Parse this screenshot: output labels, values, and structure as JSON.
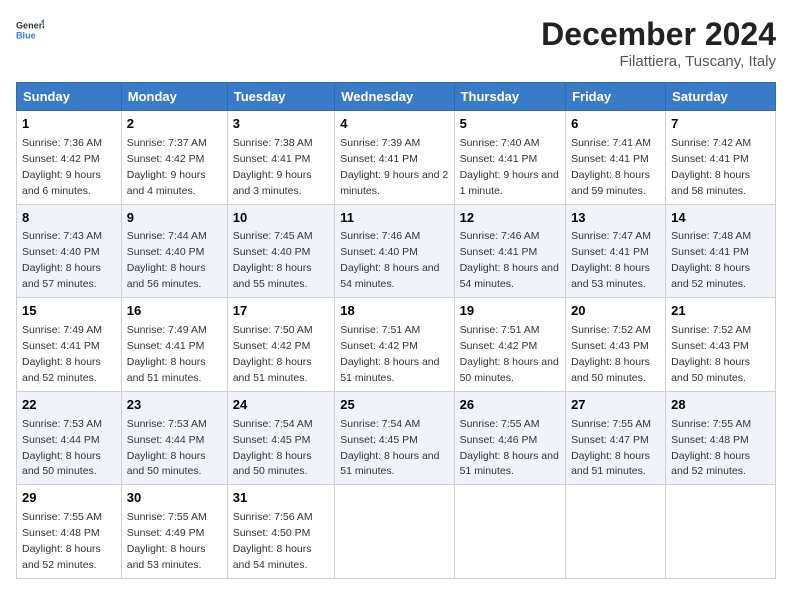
{
  "header": {
    "logo_general": "General",
    "logo_blue": "Blue",
    "title": "December 2024",
    "subtitle": "Filattiera, Tuscany, Italy"
  },
  "days_of_week": [
    "Sunday",
    "Monday",
    "Tuesday",
    "Wednesday",
    "Thursday",
    "Friday",
    "Saturday"
  ],
  "weeks": [
    [
      {
        "day": "1",
        "sunrise": "7:36 AM",
        "sunset": "4:42 PM",
        "daylight": "9 hours and 6 minutes."
      },
      {
        "day": "2",
        "sunrise": "7:37 AM",
        "sunset": "4:42 PM",
        "daylight": "9 hours and 4 minutes."
      },
      {
        "day": "3",
        "sunrise": "7:38 AM",
        "sunset": "4:41 PM",
        "daylight": "9 hours and 3 minutes."
      },
      {
        "day": "4",
        "sunrise": "7:39 AM",
        "sunset": "4:41 PM",
        "daylight": "9 hours and 2 minutes."
      },
      {
        "day": "5",
        "sunrise": "7:40 AM",
        "sunset": "4:41 PM",
        "daylight": "9 hours and 1 minute."
      },
      {
        "day": "6",
        "sunrise": "7:41 AM",
        "sunset": "4:41 PM",
        "daylight": "8 hours and 59 minutes."
      },
      {
        "day": "7",
        "sunrise": "7:42 AM",
        "sunset": "4:41 PM",
        "daylight": "8 hours and 58 minutes."
      }
    ],
    [
      {
        "day": "8",
        "sunrise": "7:43 AM",
        "sunset": "4:40 PM",
        "daylight": "8 hours and 57 minutes."
      },
      {
        "day": "9",
        "sunrise": "7:44 AM",
        "sunset": "4:40 PM",
        "daylight": "8 hours and 56 minutes."
      },
      {
        "day": "10",
        "sunrise": "7:45 AM",
        "sunset": "4:40 PM",
        "daylight": "8 hours and 55 minutes."
      },
      {
        "day": "11",
        "sunrise": "7:46 AM",
        "sunset": "4:40 PM",
        "daylight": "8 hours and 54 minutes."
      },
      {
        "day": "12",
        "sunrise": "7:46 AM",
        "sunset": "4:41 PM",
        "daylight": "8 hours and 54 minutes."
      },
      {
        "day": "13",
        "sunrise": "7:47 AM",
        "sunset": "4:41 PM",
        "daylight": "8 hours and 53 minutes."
      },
      {
        "day": "14",
        "sunrise": "7:48 AM",
        "sunset": "4:41 PM",
        "daylight": "8 hours and 52 minutes."
      }
    ],
    [
      {
        "day": "15",
        "sunrise": "7:49 AM",
        "sunset": "4:41 PM",
        "daylight": "8 hours and 52 minutes."
      },
      {
        "day": "16",
        "sunrise": "7:49 AM",
        "sunset": "4:41 PM",
        "daylight": "8 hours and 51 minutes."
      },
      {
        "day": "17",
        "sunrise": "7:50 AM",
        "sunset": "4:42 PM",
        "daylight": "8 hours and 51 minutes."
      },
      {
        "day": "18",
        "sunrise": "7:51 AM",
        "sunset": "4:42 PM",
        "daylight": "8 hours and 51 minutes."
      },
      {
        "day": "19",
        "sunrise": "7:51 AM",
        "sunset": "4:42 PM",
        "daylight": "8 hours and 50 minutes."
      },
      {
        "day": "20",
        "sunrise": "7:52 AM",
        "sunset": "4:43 PM",
        "daylight": "8 hours and 50 minutes."
      },
      {
        "day": "21",
        "sunrise": "7:52 AM",
        "sunset": "4:43 PM",
        "daylight": "8 hours and 50 minutes."
      }
    ],
    [
      {
        "day": "22",
        "sunrise": "7:53 AM",
        "sunset": "4:44 PM",
        "daylight": "8 hours and 50 minutes."
      },
      {
        "day": "23",
        "sunrise": "7:53 AM",
        "sunset": "4:44 PM",
        "daylight": "8 hours and 50 minutes."
      },
      {
        "day": "24",
        "sunrise": "7:54 AM",
        "sunset": "4:45 PM",
        "daylight": "8 hours and 50 minutes."
      },
      {
        "day": "25",
        "sunrise": "7:54 AM",
        "sunset": "4:45 PM",
        "daylight": "8 hours and 51 minutes."
      },
      {
        "day": "26",
        "sunrise": "7:55 AM",
        "sunset": "4:46 PM",
        "daylight": "8 hours and 51 minutes."
      },
      {
        "day": "27",
        "sunrise": "7:55 AM",
        "sunset": "4:47 PM",
        "daylight": "8 hours and 51 minutes."
      },
      {
        "day": "28",
        "sunrise": "7:55 AM",
        "sunset": "4:48 PM",
        "daylight": "8 hours and 52 minutes."
      }
    ],
    [
      {
        "day": "29",
        "sunrise": "7:55 AM",
        "sunset": "4:48 PM",
        "daylight": "8 hours and 52 minutes."
      },
      {
        "day": "30",
        "sunrise": "7:55 AM",
        "sunset": "4:49 PM",
        "daylight": "8 hours and 53 minutes."
      },
      {
        "day": "31",
        "sunrise": "7:56 AM",
        "sunset": "4:50 PM",
        "daylight": "8 hours and 54 minutes."
      },
      null,
      null,
      null,
      null
    ]
  ],
  "labels": {
    "sunrise": "Sunrise:",
    "sunset": "Sunset:",
    "daylight": "Daylight:"
  }
}
